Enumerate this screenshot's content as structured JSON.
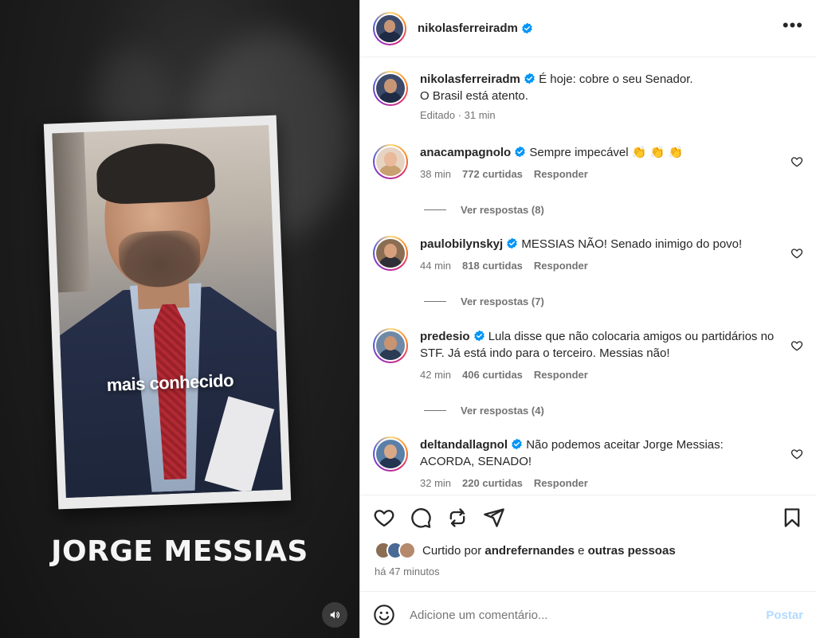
{
  "media": {
    "photo_caption": "mais conhecido",
    "headline": "JORGE MESSIAS",
    "audio_icon": "speaker-icon"
  },
  "post": {
    "author": "nikolasferreiradm",
    "caption_line1": "É hoje: cobre o seu Senador.",
    "caption_line2": "O Brasil está atento.",
    "caption_meta": "Editado · 31 min"
  },
  "comments": [
    {
      "username": "anacampagnolo",
      "text": "Sempre impecável 👏 👏 👏",
      "time": "38 min",
      "likes": "772 curtidas",
      "reply_label": "Responder",
      "replies": "Ver respostas (8)"
    },
    {
      "username": "paulobilynskyj",
      "text": "MESSIAS NÃO! Senado inimigo do povo!",
      "time": "44 min",
      "likes": "818 curtidas",
      "reply_label": "Responder",
      "replies": "Ver respostas (7)"
    },
    {
      "username": "predesio",
      "text": "Lula disse que não colocaria amigos ou partidários no STF. Já está indo para o terceiro. Messias não!",
      "time": "42 min",
      "likes": "406 curtidas",
      "reply_label": "Responder",
      "replies": "Ver respostas (4)"
    },
    {
      "username": "deltandallagnol",
      "text": "Não podemos aceitar Jorge Messias: ACORDA, SENADO!",
      "time": "32 min",
      "likes": "220 curtidas",
      "reply_label": "Responder"
    }
  ],
  "likes_bar": {
    "prefix": "Curtido por",
    "user": "andrefernandes",
    "connector": "e",
    "others": "outras pessoas"
  },
  "time_ago": "há 47 minutos",
  "add_comment": {
    "placeholder": "Adicione um comentário...",
    "post_label": "Postar"
  },
  "colors": {
    "verified": "#0095f6",
    "post_disabled": "#b3dbff",
    "secondary_text": "#737373"
  }
}
